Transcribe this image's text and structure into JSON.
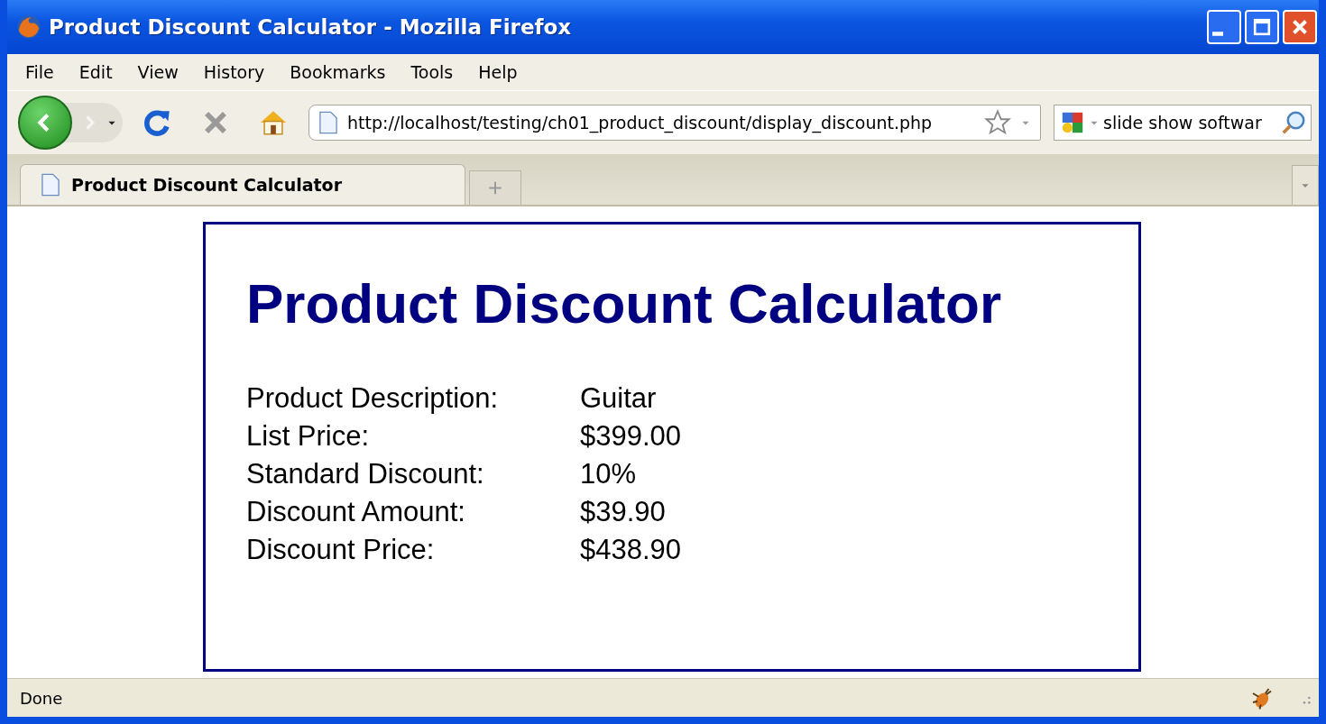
{
  "window": {
    "title": "Product Discount Calculator - Mozilla Firefox"
  },
  "menu": [
    "File",
    "Edit",
    "View",
    "History",
    "Bookmarks",
    "Tools",
    "Help"
  ],
  "address_bar": {
    "value": "http://localhost/testing/ch01_product_discount/display_discount.php"
  },
  "search": {
    "value": "slide show softwar"
  },
  "tabs": [
    {
      "label": "Product Discount Calculator",
      "selected": true
    }
  ],
  "page": {
    "heading": "Product Discount Calculator",
    "rows": [
      {
        "label": "Product Description:",
        "value": "Guitar"
      },
      {
        "label": "List Price:",
        "value": "$399.00"
      },
      {
        "label": "Standard Discount:",
        "value": "10%"
      },
      {
        "label": "Discount Amount:",
        "value": "$39.90"
      },
      {
        "label": "Discount Price:",
        "value": "$438.90"
      }
    ]
  },
  "status_bar": {
    "text": "Done"
  }
}
